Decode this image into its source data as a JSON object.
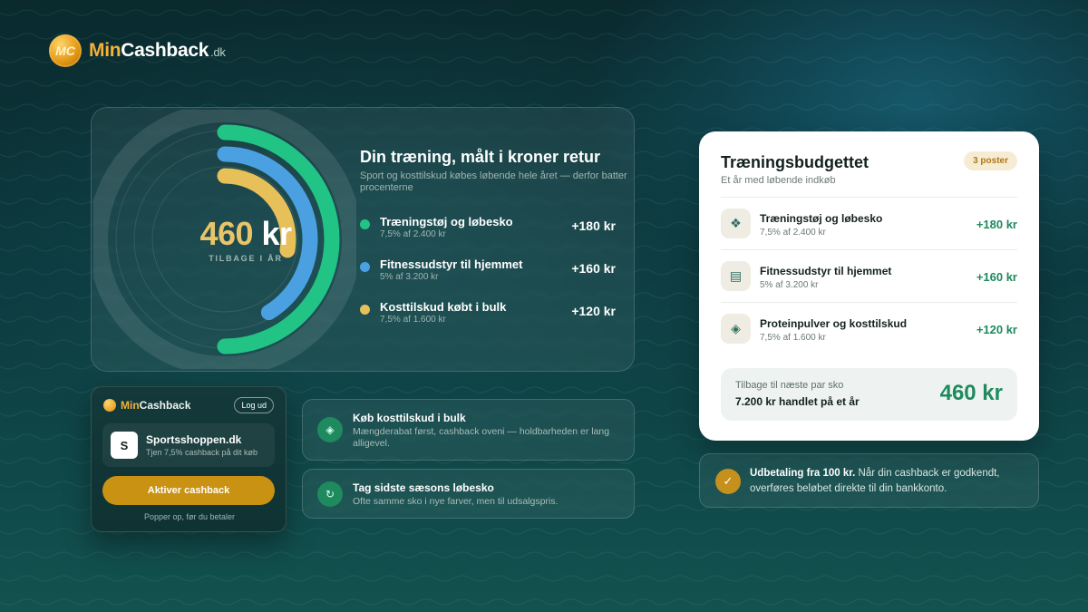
{
  "brand": {
    "min": "Min",
    "cash": "Cashback",
    "tld": ".dk",
    "coin_initials": "MC"
  },
  "hero": {
    "amount_number": "460",
    "amount_unit": "kr",
    "amount_label": "TILBAGE I ÅR",
    "title": "Din træning, målt i kroner retur",
    "description": "Sport og kosttilskud købes løbende hele året — derfor batter procenterne",
    "items": [
      {
        "name": "Træningstøj og løbesko",
        "meta": "7,5% af 2.400 kr",
        "value": "+180 kr",
        "color": "#22c486",
        "share": 0.391
      },
      {
        "name": "Fitnessudstyr til hjemmet",
        "meta": "5% af 3.200 kr",
        "value": "+160 kr",
        "color": "#4aa0e0",
        "share": 0.348
      },
      {
        "name": "Kosttilskud købt i bulk",
        "meta": "7,5% af 1.600 kr",
        "value": "+120 kr",
        "color": "#e8c05a",
        "share": 0.261
      }
    ]
  },
  "budget": {
    "title": "Træningsbudgettet",
    "subtitle": "Et år med løbende indkøb",
    "badge": "3 poster",
    "rows": [
      {
        "icon": "❖",
        "icon_name": "grid-icon",
        "name": "Træningstøj og løbesko",
        "meta": "7,5% af 2.400 kr",
        "value": "+180 kr"
      },
      {
        "icon": "▤",
        "icon_name": "equipment-icon",
        "name": "Fitnessudstyr til hjemmet",
        "meta": "5% af 3.200 kr",
        "value": "+160 kr"
      },
      {
        "icon": "◈",
        "icon_name": "supplement-icon",
        "name": "Proteinpulver og kosttilskud",
        "meta": "7,5% af 1.600 kr",
        "value": "+120 kr"
      }
    ],
    "summary_label": "Tilbage til næste par sko",
    "summary_text": "7.200 kr handlet på et år",
    "summary_value": "460 kr"
  },
  "payout": {
    "bold": "Udbetaling fra 100 kr.",
    "text": " Når din cashback er godkendt, overføres beløbet direkte til din bankkonto.",
    "icon": "✓"
  },
  "extension": {
    "brand_min": "Min",
    "brand_cash": "Cashback",
    "logout": "Log ud",
    "shop_initial": "S",
    "shop_name": "Sportsshoppen.dk",
    "shop_sub": "Tjen 7,5% cashback på dit køb",
    "button": "Aktiver cashback",
    "footer": "Popper op, før du betaler"
  },
  "tips": [
    {
      "icon": "◈",
      "title": "Køb kosttilskud i bulk",
      "text": "Mængderabat først, cashback oveni — holdbarheden er lang alligevel."
    },
    {
      "icon": "↻",
      "title": "Tag sidste sæsons løbesko",
      "text": "Ofte samme sko i nye farver, men til udsalgspris."
    }
  ]
}
